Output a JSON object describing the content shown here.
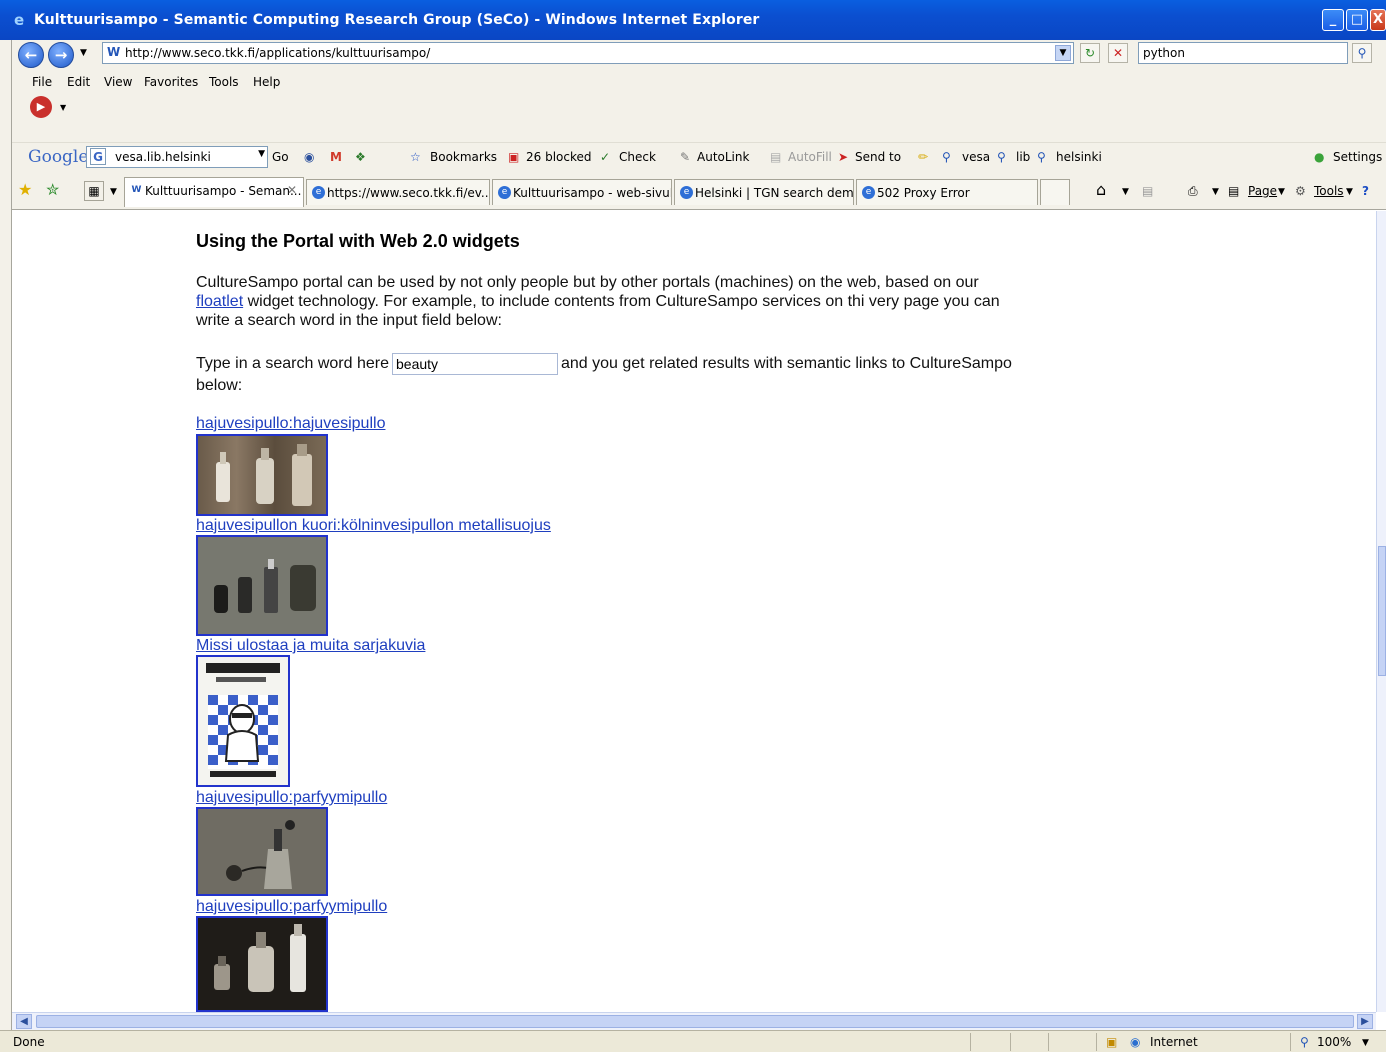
{
  "window": {
    "title": "Kulttuurisampo - Semantic Computing Research Group (SeCo) - Windows Internet Explorer",
    "minimize_glyph": "_",
    "maximize_glyph": "□",
    "close_glyph": "X"
  },
  "address_bar": {
    "url": "http://www.seco.tkk.fi/applications/kulttuurisampo/",
    "search_value": "python"
  },
  "menu": {
    "items": [
      "File",
      "Edit",
      "View",
      "Favorites",
      "Tools",
      "Help"
    ]
  },
  "google_toolbar": {
    "logo": "Google",
    "search_value": "vesa.lib.helsinki",
    "go_label": "Go",
    "bookmarks_label": "Bookmarks",
    "blocked_label": "26 blocked",
    "check_label": "Check",
    "autolink_label": "AutoLink",
    "autofill_label": "AutoFill",
    "sendto_label": "Send to",
    "term1": "vesa",
    "term2": "lib",
    "term3": "helsinki",
    "settings_label": "Settings"
  },
  "tabs": [
    {
      "label": "Kulttuurisampo - Seman...",
      "active": true
    },
    {
      "label": "https://www.seco.tkk.fi/ev...",
      "active": false
    },
    {
      "label": "Kulttuurisampo - web-sivuK...",
      "active": false
    },
    {
      "label": "Helsinki | TGN search demo",
      "active": false
    },
    {
      "label": "502 Proxy Error",
      "active": false
    }
  ],
  "command_bar": {
    "page_label": "Page",
    "tools_label": "Tools"
  },
  "content": {
    "heading": "Using the Portal with Web 2.0 widgets",
    "para_before_link": "CultureSampo portal can be used by not only people but by other portals (machines) on the web, based on our ",
    "para_link": "floatlet",
    "para_after_link": " widget technology. For example, to include contents from CultureSampo services on thi very page you can write a search word in the input field below:",
    "search_prefix": "Type in a search word here",
    "search_value": "beauty",
    "search_suffix": "and you get related results with semantic links to CultureSampo below:",
    "results": [
      {
        "label": "hajuvesipullo:hajuvesipullo"
      },
      {
        "label": "hajuvesipullon kuori:kölninvesipullon metallisuojus"
      },
      {
        "label": "Missi ulostaa ja muita sarjakuvia"
      },
      {
        "label": "hajuvesipullo:parfyymipullo"
      },
      {
        "label": "hajuvesipullo:parfyymipullo"
      }
    ]
  },
  "status": {
    "text": "Done",
    "zone": "Internet",
    "zoom": "100%"
  }
}
